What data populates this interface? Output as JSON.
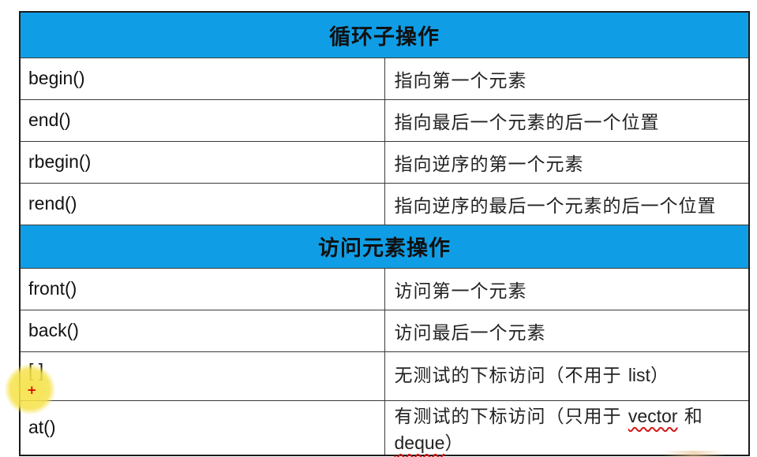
{
  "sections": [
    {
      "title": "循环子操作",
      "rows": [
        {
          "fn": "begin()",
          "desc": "指向第一个元素"
        },
        {
          "fn": "end()",
          "desc": "指向最后一个元素的后一个位置"
        },
        {
          "fn": "rbegin()",
          "desc": "指向逆序的第一个元素"
        },
        {
          "fn": "rend()",
          "desc": "指向逆序的最后一个元素的后一个位置"
        }
      ]
    },
    {
      "title": "访问元素操作",
      "rows": [
        {
          "fn": "front()",
          "desc": "访问第一个元素"
        },
        {
          "fn": "back()",
          "desc": "访问最后一个元素"
        },
        {
          "fn": "[ ]",
          "desc_pre": "无测试的下标访问（不用于 ",
          "desc_code": "list",
          "desc_post": "）"
        },
        {
          "fn": "at()",
          "desc_pre": "有测试的下标访问（只用于 ",
          "desc_code1": "vector",
          "desc_mid": " 和 ",
          "desc_code2": "deque",
          "desc_post": "）"
        }
      ]
    }
  ],
  "colors": {
    "header_bg": "#0f9ee6",
    "border": "#1a1a1a",
    "cursor_highlight": "#f6e24a",
    "cursor_mark": "#d40000",
    "squiggle": "#d11919"
  },
  "cursor": {
    "glyph": "+"
  }
}
